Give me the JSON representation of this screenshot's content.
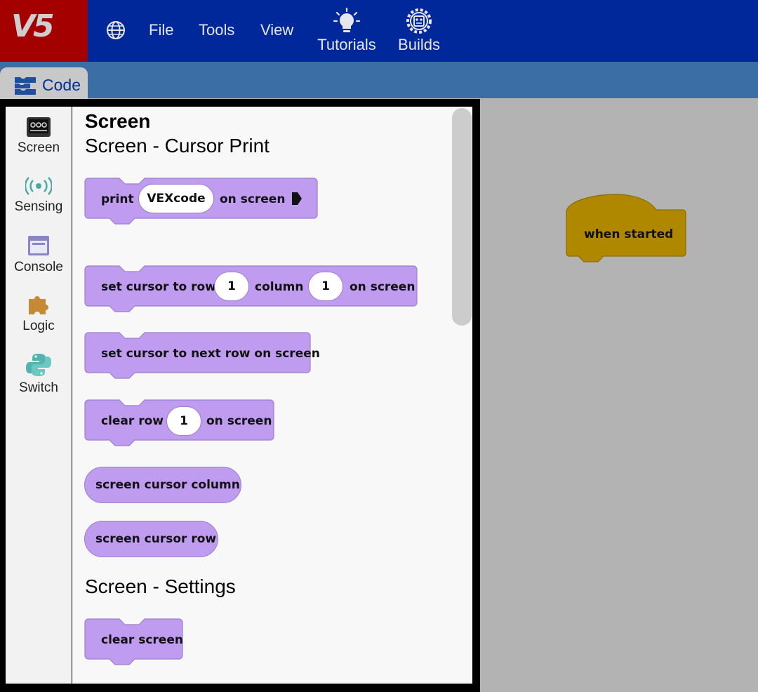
{
  "topbar": {
    "logo_text": "V5",
    "globe_icon": "globe-icon",
    "menu": [
      "File",
      "Tools",
      "View"
    ],
    "tutorials_label": "Tutorials",
    "builds_label": "Builds",
    "tutorials_icon": "lightbulb-icon",
    "builds_icon": "gear-robot-icon",
    "bar_color": "#00289a",
    "logo_bg": "#a40000"
  },
  "tabs": {
    "code_label": "Code",
    "code_icon": "blocks-icon"
  },
  "categories": [
    {
      "label": "Screen",
      "icon": "screen-icon"
    },
    {
      "label": "Sensing",
      "icon": "sensing-icon"
    },
    {
      "label": "Console",
      "icon": "console-icon"
    },
    {
      "label": "Logic",
      "icon": "puzzle-icon"
    },
    {
      "label": "Switch",
      "icon": "python-icon"
    }
  ],
  "flyout": {
    "title": "Screen",
    "section_cursor": "Screen - Cursor Print",
    "section_settings": "Screen - Settings",
    "print_block": {
      "word1": "print",
      "value": "VEXcode",
      "word2": "on screen"
    },
    "set_cursor_block": {
      "word1": "set cursor to row",
      "row": "1",
      "word2": "column",
      "col": "1",
      "word3": "on screen"
    },
    "next_row_block": {
      "text": "set cursor to next row on screen"
    },
    "clear_row_block": {
      "word1": "clear row",
      "row": "1",
      "word2": "on screen"
    },
    "cursor_column_reporter": "screen cursor column",
    "cursor_row_reporter": "screen cursor row",
    "clear_screen_block": "clear screen",
    "block_color": "#bf9cf0"
  },
  "workspace": {
    "hat_block": "when started",
    "hat_color": "#b08800"
  }
}
